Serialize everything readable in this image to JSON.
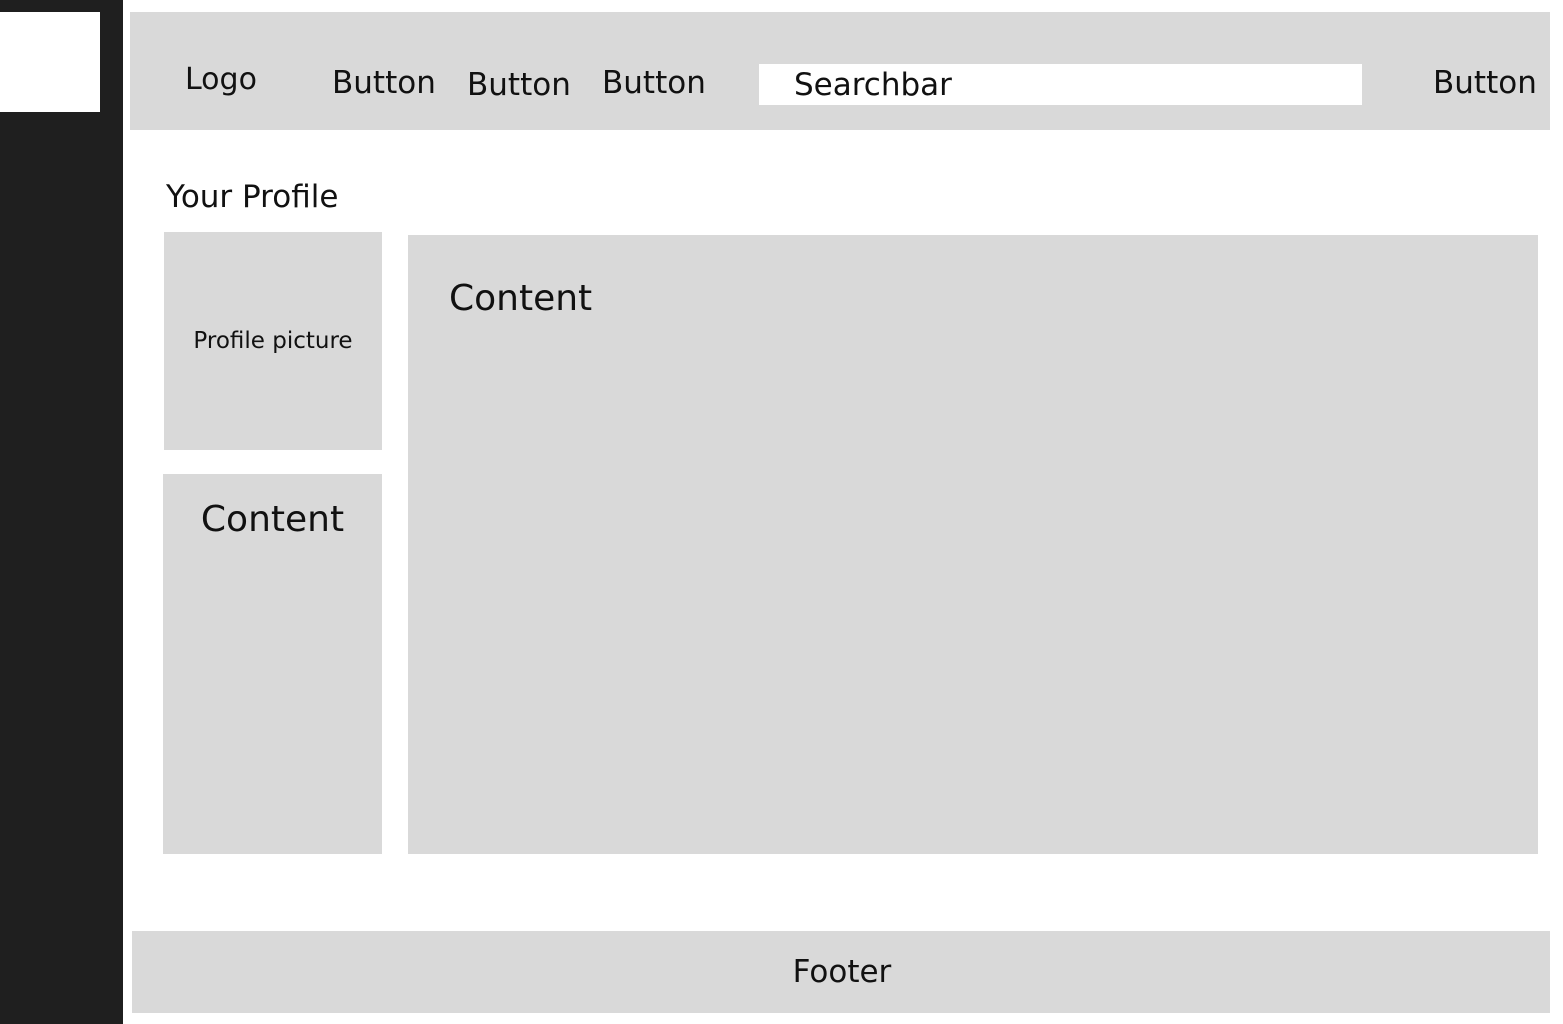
{
  "header": {
    "logo": "Logo",
    "nav_buttons": [
      "Button",
      "Button",
      "Button"
    ],
    "search_placeholder": "Searchbar",
    "right_button": "Button"
  },
  "page": {
    "title": "Your Profile"
  },
  "profile": {
    "picture_label": "Profile picture",
    "side_content": "Content"
  },
  "main": {
    "content": "Content"
  },
  "footer": {
    "label": "Footer"
  },
  "colors": {
    "sidebar": "#1f1f1f",
    "panel": "#d9d9d9",
    "background": "#ffffff"
  }
}
